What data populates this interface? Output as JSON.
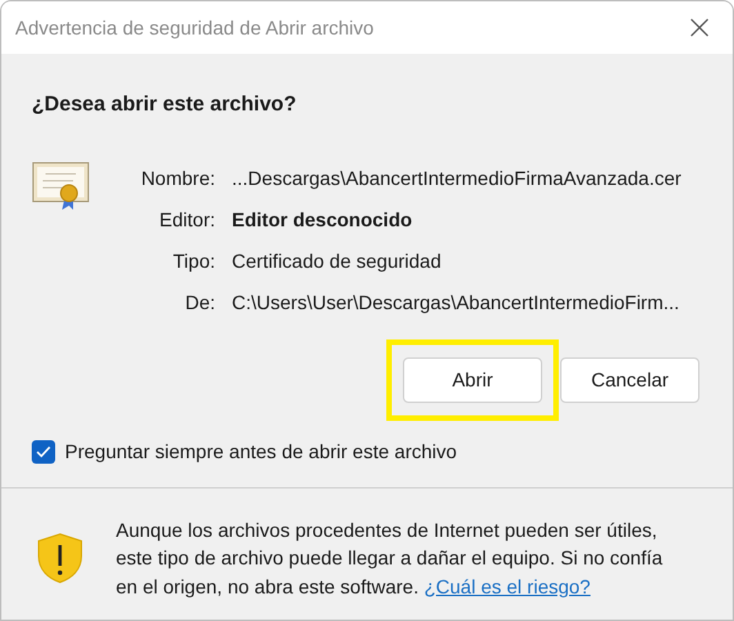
{
  "window": {
    "title": "Advertencia de seguridad de Abrir archivo"
  },
  "heading": "¿Desea abrir este archivo?",
  "fields": [
    {
      "label": "Nombre:",
      "value": "...Descargas\\AbancertIntermedioFirmaAvanzada.cer",
      "kind": "plain"
    },
    {
      "label": "Editor:",
      "value": "Editor desconocido",
      "kind": "emphasis"
    },
    {
      "label": "Tipo:",
      "value": "Certificado de seguridad",
      "kind": "plain"
    },
    {
      "label": "De:",
      "value": "C:\\Users\\User\\Descargas\\AbancertIntermedioFirm...",
      "kind": "plain"
    }
  ],
  "buttons": [
    {
      "label": "Abrir",
      "highlighted": true
    },
    {
      "label": "Cancelar",
      "highlighted": false
    }
  ],
  "checkbox": {
    "label": "Preguntar siempre antes de abrir este archivo",
    "checked": true
  },
  "warning": {
    "text": "Aunque los archivos procedentes de Internet pueden ser útiles, este tipo de archivo puede llegar a dañar el equipo. Si no confía en el origen, no abra este software.",
    "link": "¿Cuál es el riesgo?"
  }
}
